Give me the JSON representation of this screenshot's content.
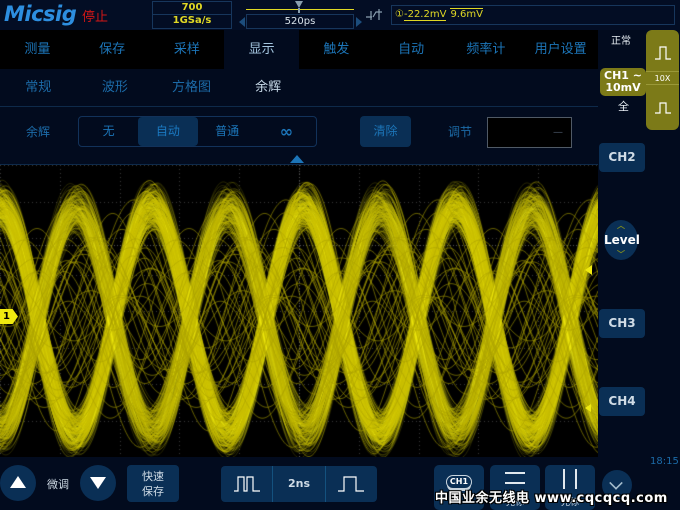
{
  "topbar": {
    "brand": "Micsig",
    "run_state": "停止",
    "memory_depth": "700",
    "sample_rate": "1GSa/s",
    "horizontal_position": "520ps",
    "trigger_type_icon": "edge-trigger-icon",
    "trigger_channel": "①",
    "trigger_level": "-22.2mV",
    "trigger_hysteresis": "9.6mV"
  },
  "menu": {
    "tabs": [
      {
        "label": "测量",
        "active": false
      },
      {
        "label": "保存",
        "active": false
      },
      {
        "label": "采样",
        "active": false
      },
      {
        "label": "显示",
        "active": true
      },
      {
        "label": "触发",
        "active": false
      },
      {
        "label": "自动",
        "active": false
      },
      {
        "label": "频率计",
        "active": false
      },
      {
        "label": "用户设置",
        "active": false
      }
    ],
    "subtabs": [
      {
        "label": "常规",
        "active": false
      },
      {
        "label": "波形",
        "active": false
      },
      {
        "label": "方格图",
        "active": false
      },
      {
        "label": "余辉",
        "active": true
      }
    ]
  },
  "persistence": {
    "label": "余辉",
    "options": [
      {
        "label": "无",
        "active": false
      },
      {
        "label": "自动",
        "active": true
      },
      {
        "label": "普通",
        "active": false
      },
      {
        "label": "∞",
        "active": false
      }
    ],
    "clear_label": "清除",
    "adjust_label": "调节",
    "adjust_value": "—"
  },
  "scope": {
    "channel_marker": "1",
    "trace_color": "#f0ea10",
    "grid_color": "#3a3a3a"
  },
  "right_panel": {
    "trigger_mode": "正常",
    "ch1_label": "CH1 ~",
    "ch1_scale": "10mV",
    "ch1_bandwidth": "全",
    "probe_ratio": "10X",
    "ch2": "CH2",
    "level": "Level",
    "ch3": "CH3",
    "ch4": "CH4",
    "clock": "18:15"
  },
  "bottom": {
    "fine_label": "微调",
    "quick_save_line1": "快速",
    "quick_save_line2": "保存",
    "timebase": "2ns",
    "ch1_pill": "CH1",
    "cursor_h_label": "光标",
    "cursor_v_label": "光标"
  },
  "watermark": "中国业余无线电 www.cqcqcq.com"
}
